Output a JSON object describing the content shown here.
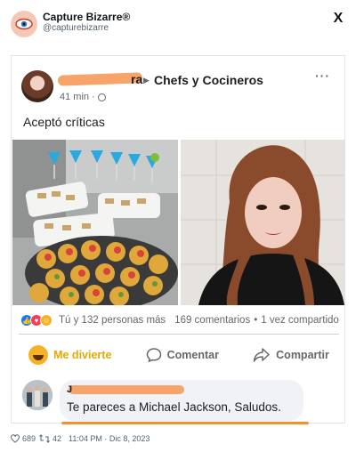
{
  "tweet": {
    "account_name": "Capture Bizarre®",
    "handle": "@capturebizarre",
    "close_glyph": "X",
    "likes": "689",
    "retweets": "42",
    "timestamp": "11:04 PM · Dic 8, 2023"
  },
  "facebook_post": {
    "author_visible_suffix": "ra",
    "group": "Chefs y Cocineros",
    "time": "41 min",
    "meta_sep": "·",
    "more": "···",
    "text": "Aceptó críticas",
    "reactions": {
      "summary": "Tú y 132 personas más",
      "comments": "169 comentarios",
      "separator": "•",
      "shares": "1 vez compartido"
    },
    "actions": {
      "reaction_label": "Me divierte",
      "comment_label": "Comentar",
      "share_label": "Compartir"
    },
    "comment": {
      "author_initial": "J",
      "text": "Te pareces a Michael Jackson, Saludos."
    }
  },
  "colors": {
    "brand_accent": "#f6a46a",
    "underline": "#f0932b",
    "haha_yellow": "#f7b125"
  }
}
